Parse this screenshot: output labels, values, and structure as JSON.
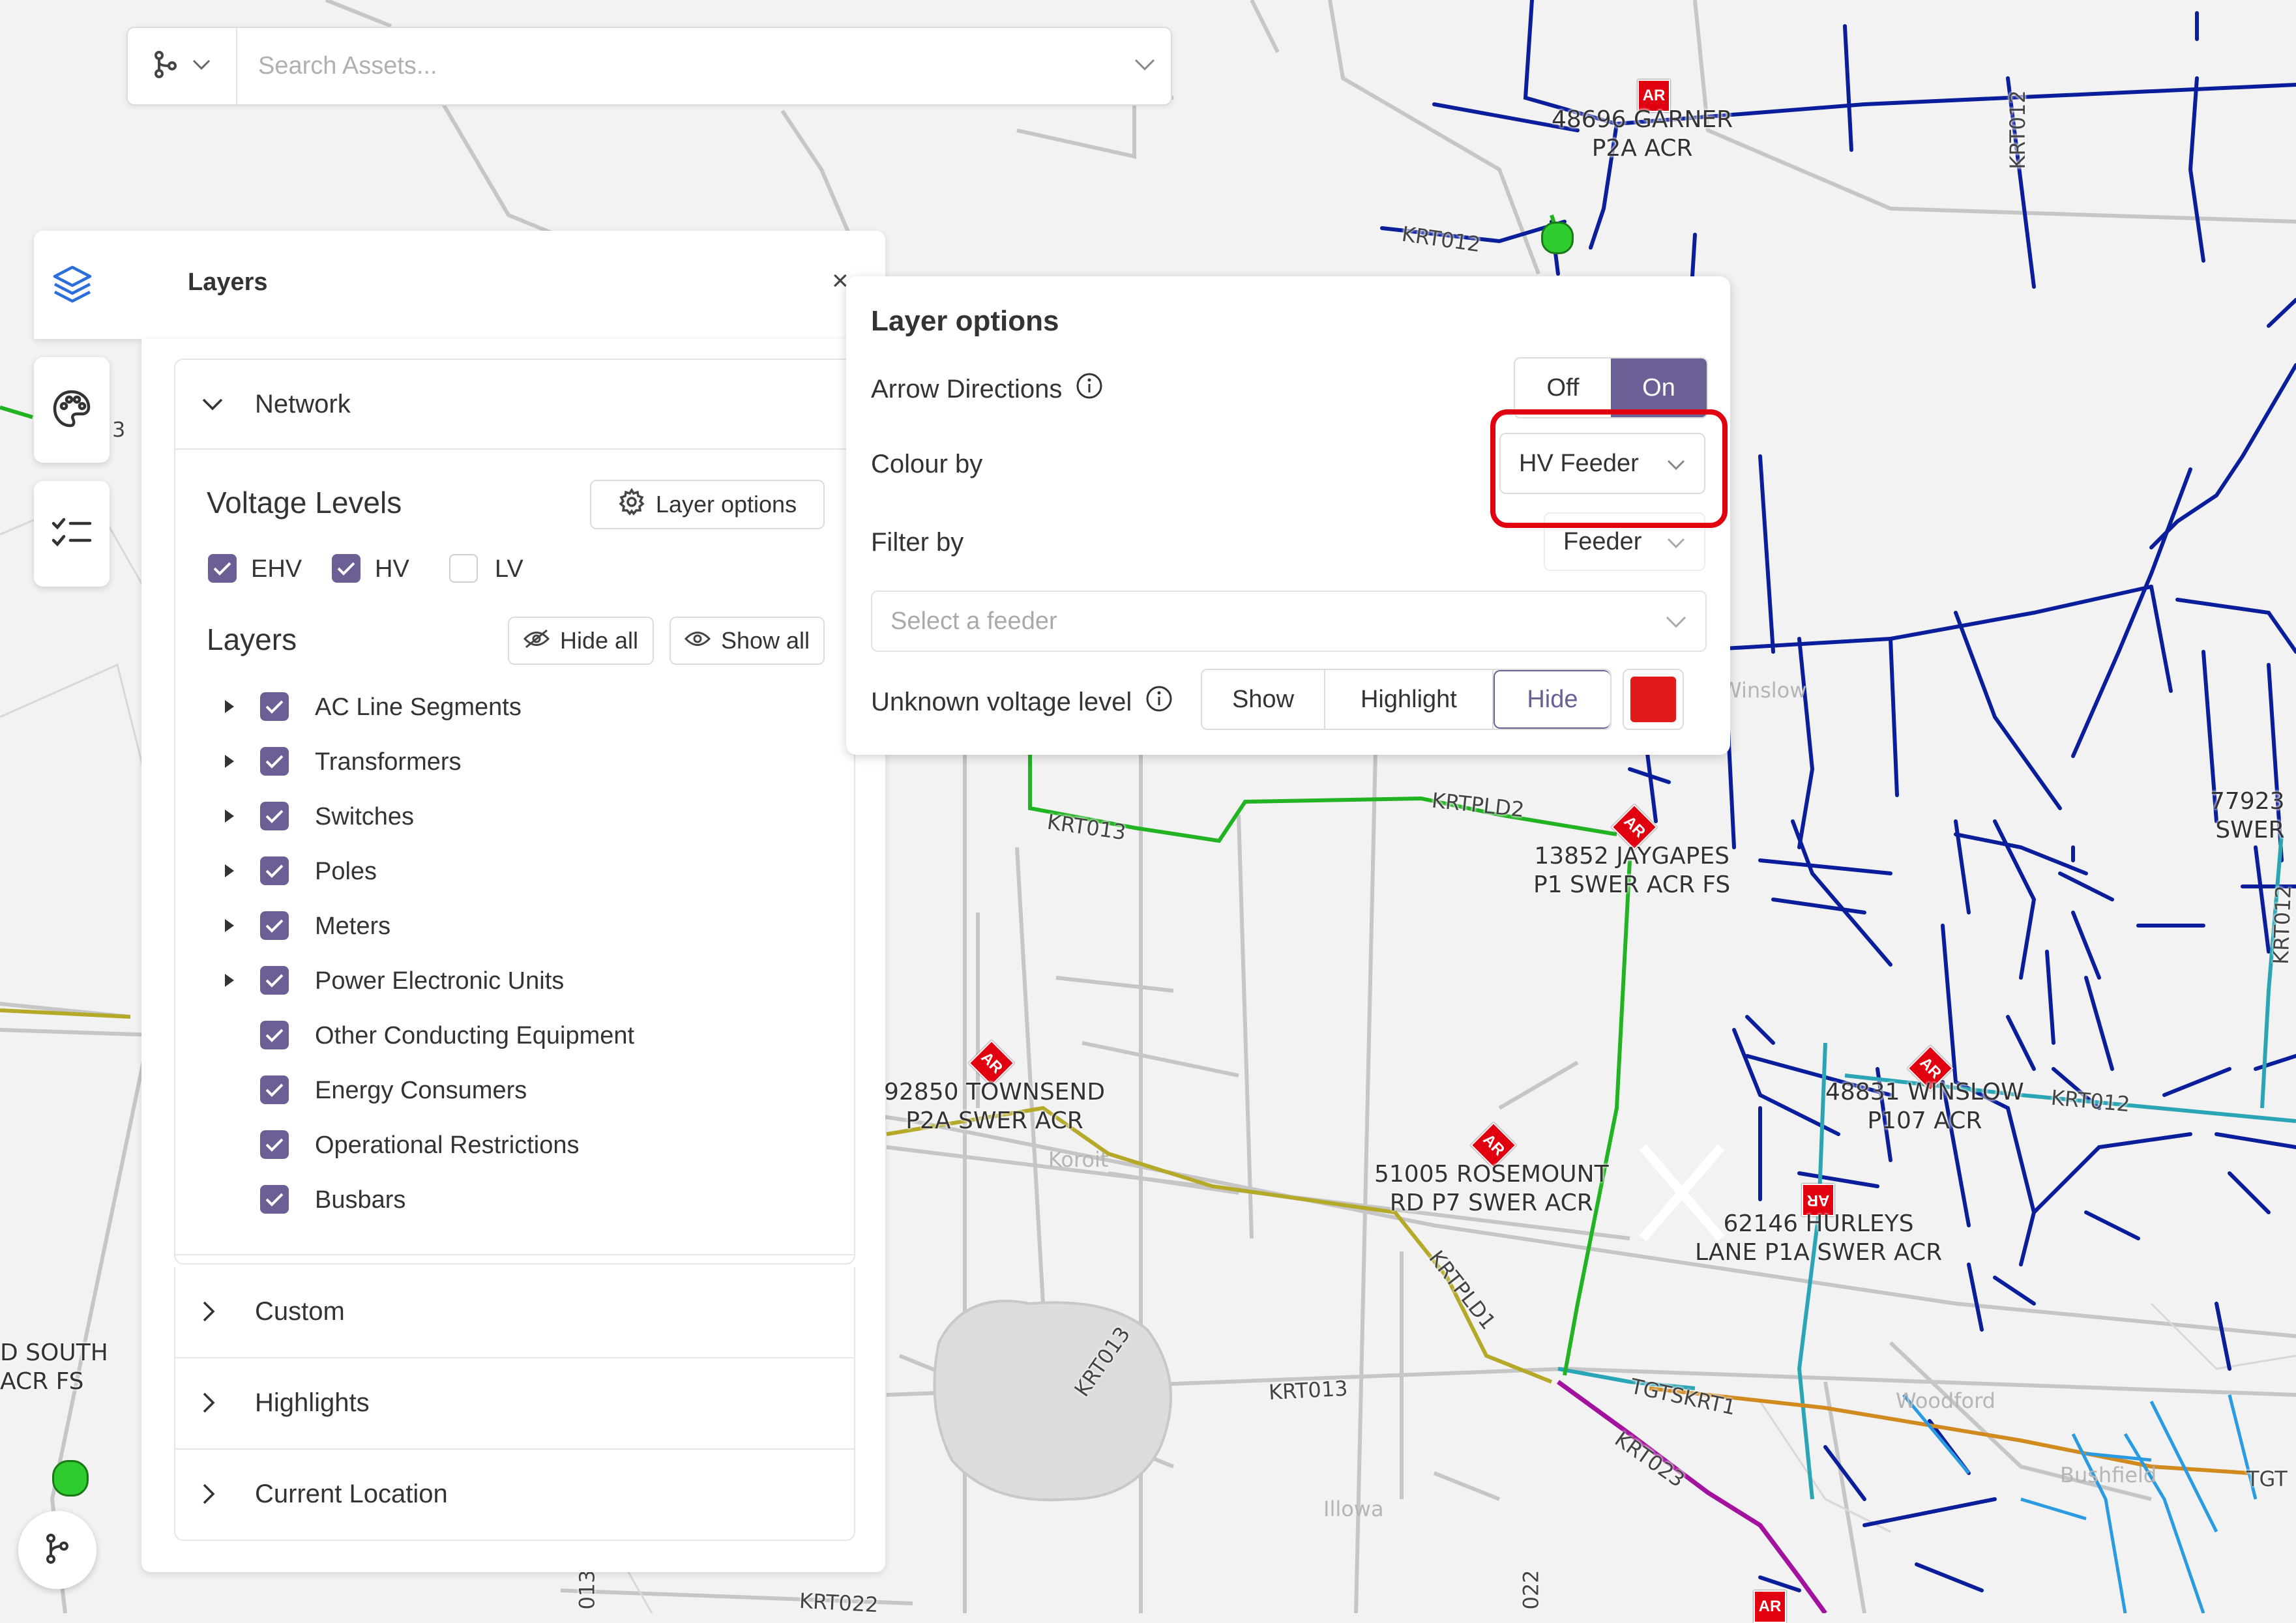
{
  "search": {
    "placeholder": "Search Assets..."
  },
  "layers_panel": {
    "title": "Layers",
    "network": {
      "label": "Network",
      "voltage_heading": "Voltage Levels",
      "layer_options_label": "Layer options",
      "voltages": [
        {
          "label": "EHV",
          "checked": true
        },
        {
          "label": "HV",
          "checked": true
        },
        {
          "label": "LV",
          "checked": false
        }
      ],
      "layers_heading": "Layers",
      "hide_all": "Hide all",
      "show_all": "Show all",
      "layers": [
        {
          "label": "AC Line Segments",
          "checked": true,
          "expandable": true
        },
        {
          "label": "Transformers",
          "checked": true,
          "expandable": true
        },
        {
          "label": "Switches",
          "checked": true,
          "expandable": true
        },
        {
          "label": "Poles",
          "checked": true,
          "expandable": true
        },
        {
          "label": "Meters",
          "checked": true,
          "expandable": true
        },
        {
          "label": "Power Electronic Units",
          "checked": true,
          "expandable": true
        },
        {
          "label": "Other Conducting Equipment",
          "checked": true,
          "expandable": false
        },
        {
          "label": "Energy Consumers",
          "checked": true,
          "expandable": false
        },
        {
          "label": "Operational Restrictions",
          "checked": true,
          "expandable": false
        },
        {
          "label": "Busbars",
          "checked": true,
          "expandable": false
        }
      ]
    },
    "sections": [
      "Custom",
      "Highlights",
      "Current Location"
    ]
  },
  "layer_options": {
    "title": "Layer options",
    "arrow_directions": {
      "label": "Arrow Directions",
      "off": "Off",
      "on": "On",
      "value": "On"
    },
    "colour_by": {
      "label": "Colour by",
      "value": "HV Feeder"
    },
    "filter_by": {
      "label": "Filter by",
      "value": "Feeder"
    },
    "feeder_select": {
      "placeholder": "Select a feeder"
    },
    "unknown_voltage": {
      "label": "Unknown voltage level",
      "options": [
        "Show",
        "Highlight",
        "Hide"
      ],
      "selected": "Hide",
      "color": "#e11a1a"
    }
  },
  "map": {
    "asset_labels": [
      "48696 GARNER\nP2A ACR",
      "13852 JAYGAPES\nP1 SWER ACR FS",
      "92850 TOWNSEND\nP2A SWER ACR",
      "51005 ROSEMOUNT\nRD P7 SWER ACR",
      "48831 WINSLOW\nP107 ACR",
      "62146 HURLEYS\nLANE P1A SWER ACR",
      "77923\nSWER",
      "D SOUTH\nACR FS"
    ],
    "line_labels": [
      "KRT012",
      "KRT012",
      "KRT012",
      "KRT012",
      "KRT013",
      "KRT013",
      "KRT013",
      "KRTPLD2",
      "KRTPLD1",
      "TGTSKRT1",
      "KRT023",
      "KRT022",
      "TGT"
    ],
    "place_labels": [
      "Koroit",
      "Winslow",
      "Woodford",
      "Bushfield",
      "Illowa"
    ],
    "ar_badge": "AR",
    "edge_fragments": [
      "3",
      "013",
      "022"
    ],
    "colors": {
      "hv_blue": "#0a1e9c",
      "green": "#22b322",
      "olive": "#b5a92a",
      "magenta": "#a3129e",
      "orange": "#d08a1e",
      "teal": "#2aa5b5",
      "light_blue": "#2a9be0",
      "accent": "#6b5f96",
      "highlight_red": "#e0000f"
    }
  }
}
